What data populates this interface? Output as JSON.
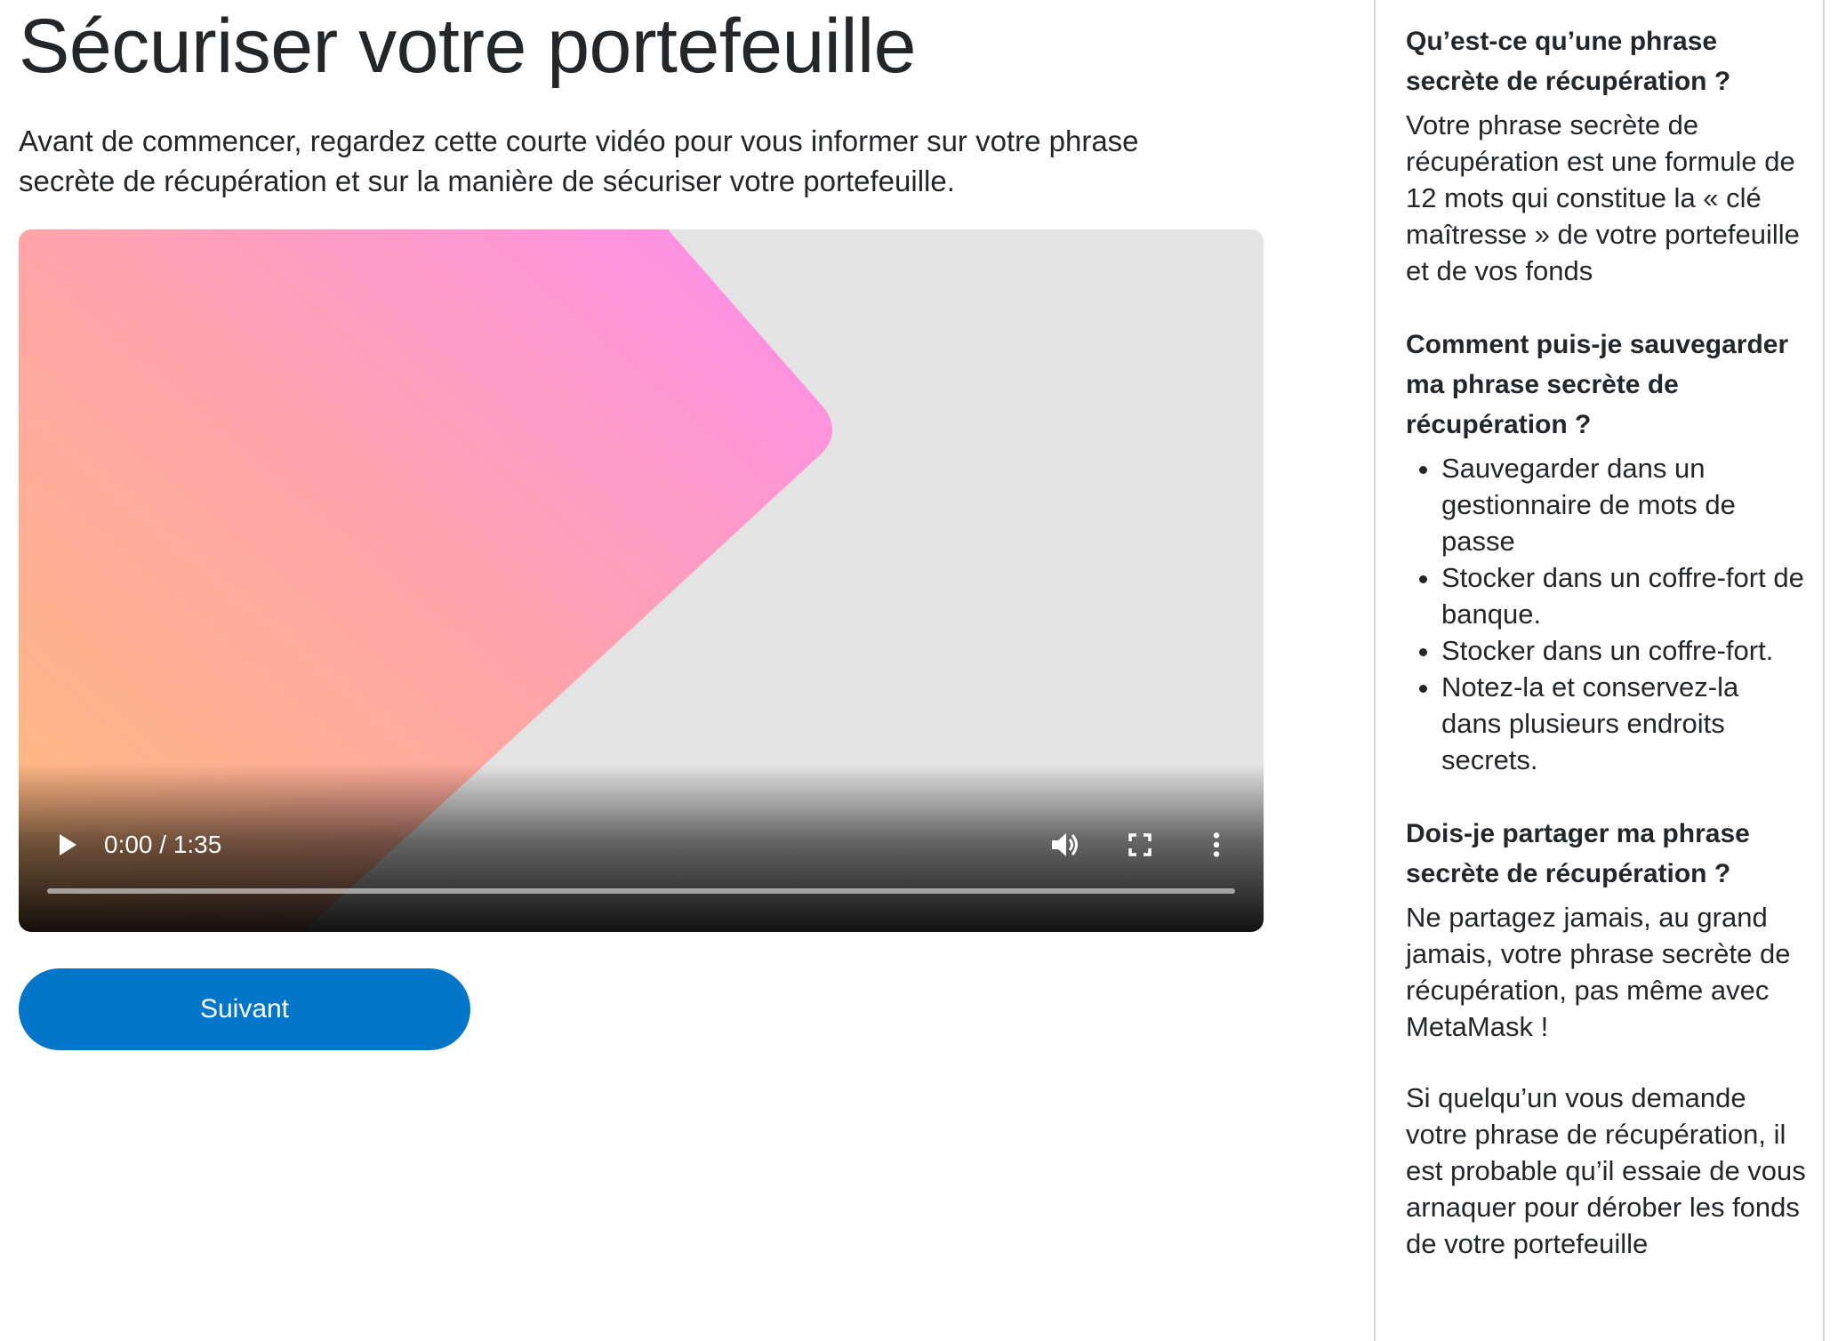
{
  "main": {
    "title": "Sécuriser votre portefeuille",
    "intro": "Avant de commencer, regardez cette courte vidéo pour vous informer sur votre phrase secrète de récupération et sur la manière de sécuriser votre portefeuille.",
    "video": {
      "time_display": "0:00 / 1:35",
      "progress": 0,
      "icons": {
        "play": "play-icon",
        "volume": "volume-icon",
        "fullscreen": "fullscreen-icon",
        "more": "more-vertical-icon"
      }
    },
    "next_button": "Suivant",
    "colors": {
      "accent": "#0376c9",
      "text": "#24272a"
    }
  },
  "sidebar": {
    "sections": [
      {
        "question": "Qu’est-ce qu’une phrase secrète de récupération ?",
        "answer": "Votre phrase secrète de récupération est une formule de 12 mots qui constitue la « clé maîtresse » de votre portefeuille et de vos fonds"
      },
      {
        "question": "Comment puis-je sauvegarder ma phrase secrète de récupération ?",
        "items": [
          "Sauvegarder dans un gestionnaire de mots de passe",
          "Stocker dans un coffre-fort de banque.",
          "Stocker dans un coffre-fort.",
          "Notez-la et conservez-la dans plusieurs endroits secrets."
        ]
      },
      {
        "question": "Dois-je partager ma phrase secrète de récupération ?",
        "answer": "Ne partagez jamais, au grand jamais, votre phrase secrète de récupération, pas même avec MetaMask !",
        "answer2": "Si quelqu’un vous demande votre phrase de récupération, il est probable qu’il essaie de vous arnaquer pour dérober les fonds de votre portefeuille"
      }
    ]
  }
}
